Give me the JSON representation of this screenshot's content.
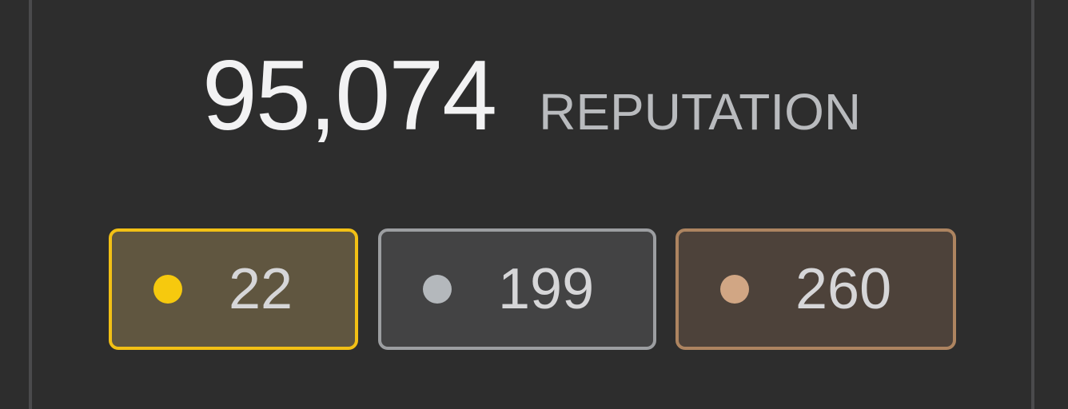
{
  "reputation": {
    "value": "95,074",
    "label": "REPUTATION"
  },
  "badges": [
    {
      "type": "gold",
      "count": "22",
      "dot_color": "#f6c90e",
      "border_color": "#f2c015",
      "bg_color": "#605640"
    },
    {
      "type": "silver",
      "count": "199",
      "dot_color": "#b4b8bc",
      "border_color": "#9c9ea1",
      "bg_color": "#434344"
    },
    {
      "type": "bronze",
      "count": "260",
      "dot_color": "#d1a684",
      "border_color": "#ad8460",
      "bg_color": "#4d423a"
    }
  ],
  "colors": {
    "background": "#2d2d2d",
    "card_border": "#4a4a4c",
    "reputation_text": "#f2f2f3",
    "label_text": "#b9bbbe"
  }
}
